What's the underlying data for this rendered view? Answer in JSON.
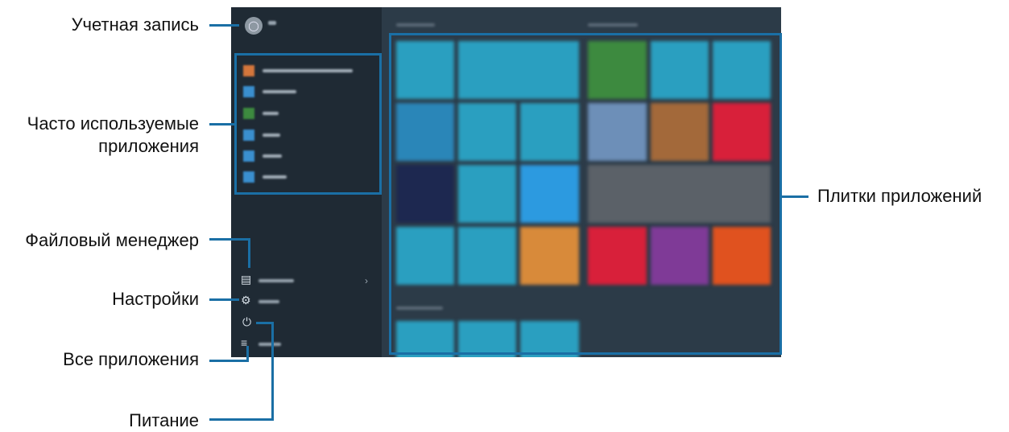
{
  "callouts": {
    "account": "Учетная запись",
    "frequent_line1": "Часто используемые",
    "frequent_line2": "приложения",
    "file_manager": "Файловый менеджер",
    "settings": "Настройки",
    "all_apps": "Все приложения",
    "power": "Питание",
    "app_tiles": "Плитки приложений"
  },
  "start_menu": {
    "account_icon": "person-icon",
    "frequent_apps_count": 6,
    "system_items": [
      "folder-icon",
      "gear-icon",
      "power-icon",
      "list-icon"
    ],
    "colors": {
      "callout_line": "#1a6fa5",
      "tile_blue": "#2a9fc0",
      "tile_green": "#3d8a3f",
      "tile_red": "#d8203a",
      "tile_purple": "#7f3a97",
      "tile_orange": "#e0521f"
    }
  }
}
